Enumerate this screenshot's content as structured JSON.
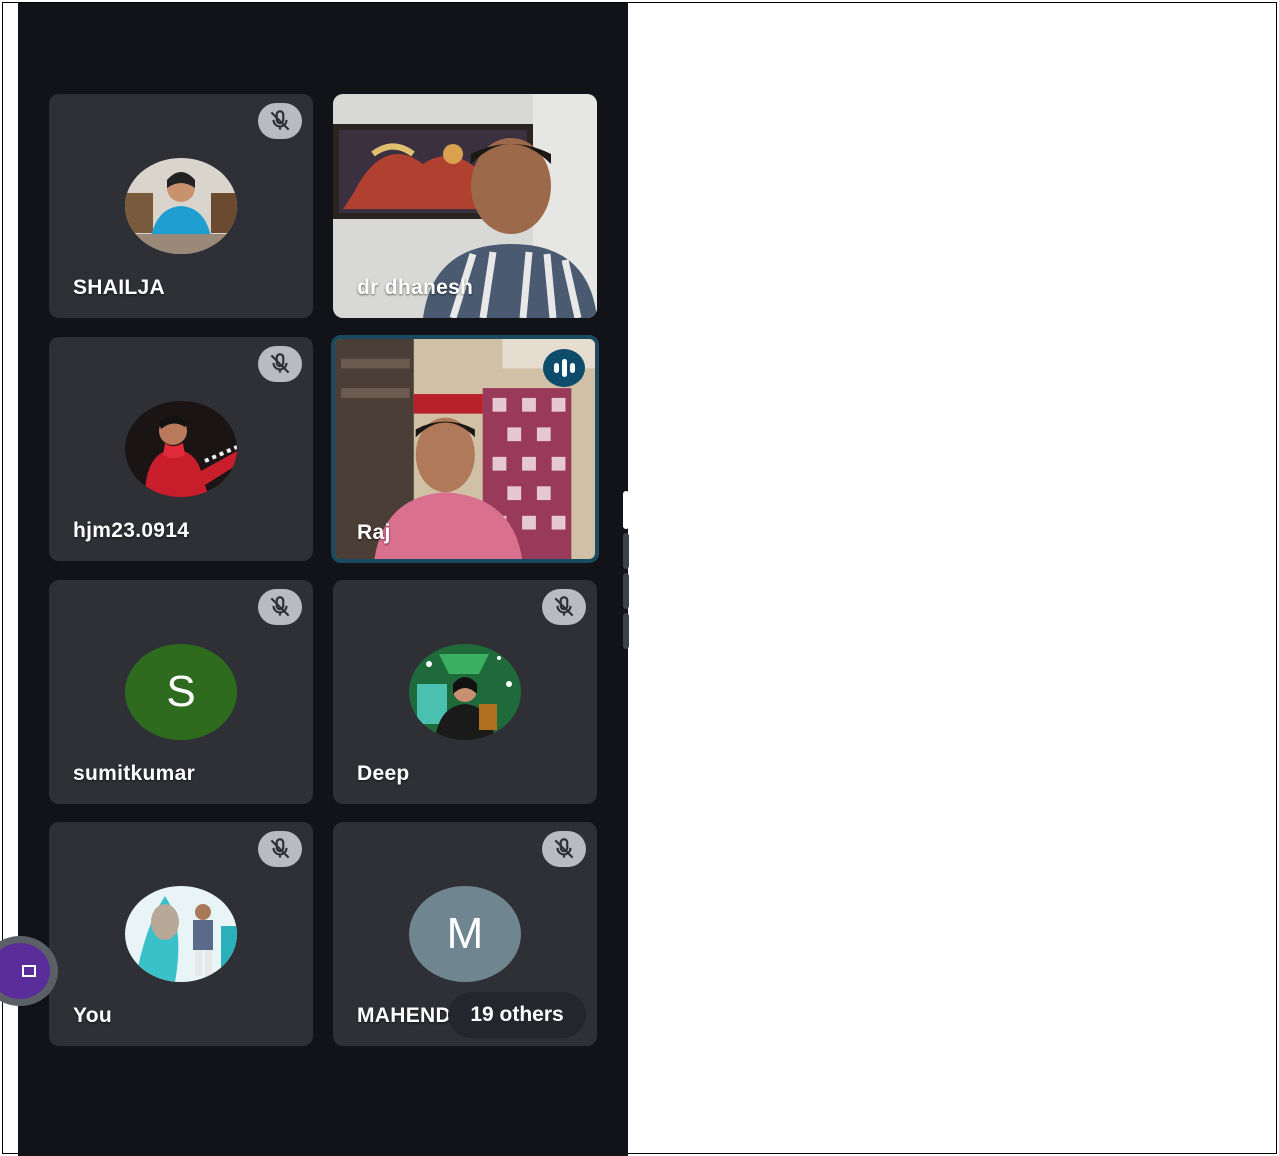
{
  "participants": [
    {
      "name": "SHAILJA",
      "muted": true,
      "tile": "avatar-photo"
    },
    {
      "name": "dr dhanesh",
      "muted": false,
      "tile": "video"
    },
    {
      "name": "hjm23.0914",
      "muted": true,
      "tile": "avatar-photo"
    },
    {
      "name": "Raj",
      "muted": false,
      "tile": "video",
      "speaking": true
    },
    {
      "name": "sumitkumar",
      "muted": true,
      "tile": "letter-avatar",
      "initial": "S",
      "color": "#2e6b1f"
    },
    {
      "name": "Deep",
      "muted": true,
      "tile": "avatar-photo"
    },
    {
      "name": "You",
      "muted": true,
      "tile": "avatar-photo"
    },
    {
      "name": "MAHEND",
      "muted": true,
      "tile": "letter-avatar",
      "initial": "M",
      "color": "#6f8590"
    }
  ],
  "others_chip": {
    "label": "19 others"
  },
  "icons": {
    "mute": "mic-off-icon",
    "speaking": "audio-level-icon",
    "fab": "screen-share-icon"
  },
  "colors": {
    "panel": "#111318",
    "tile": "#2e3035",
    "active_border": "#1a4a60",
    "fab": "#5b2d9a"
  }
}
